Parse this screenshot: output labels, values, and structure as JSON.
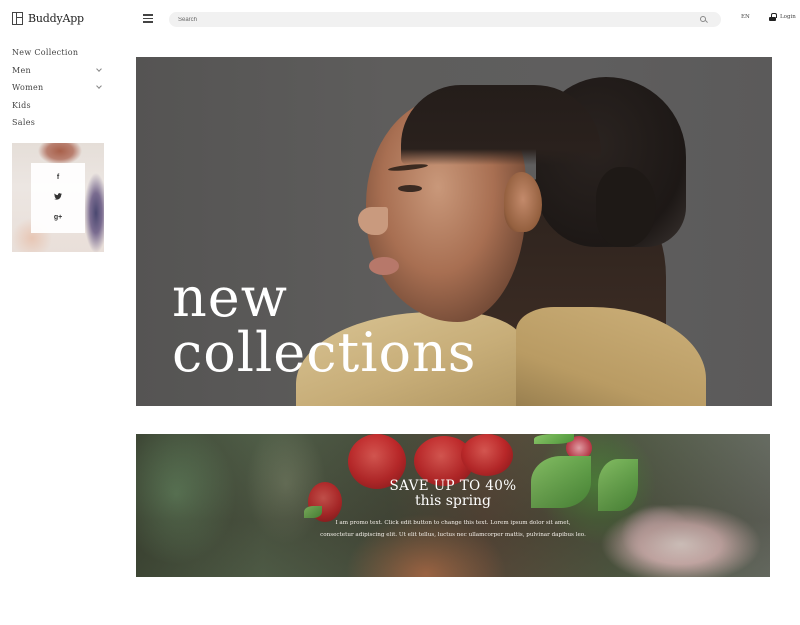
{
  "header": {
    "app_name": "BuddyApp",
    "search_placeholder": "Search",
    "language": "EN",
    "login_label": "Login"
  },
  "sidebar": {
    "items": [
      {
        "label": "New Collection",
        "has_submenu": false
      },
      {
        "label": "Men",
        "has_submenu": true
      },
      {
        "label": "Women",
        "has_submenu": true
      },
      {
        "label": "Kids",
        "has_submenu": false
      },
      {
        "label": "Sales",
        "has_submenu": false
      }
    ],
    "social": {
      "facebook": "f",
      "twitter": "❛",
      "google_plus": "g+"
    }
  },
  "hero": {
    "title_line1": "new",
    "title_line2": "collections"
  },
  "banner": {
    "title": "SAVE UP TO 40%",
    "subtitle": "this spring",
    "text_line1": "I am promo text. Click edit button to change this text. Lorem ipsum dolor sit amet,",
    "text_line2": "consectetur adipiscing elit. Ut elit tellus, luctus nec ullamcorper mattis, pulvinar dapibus leo."
  },
  "colors": {
    "hero_bg": "#5e5d5c",
    "text_dark": "#444444",
    "search_bg": "#f1f1f1"
  }
}
